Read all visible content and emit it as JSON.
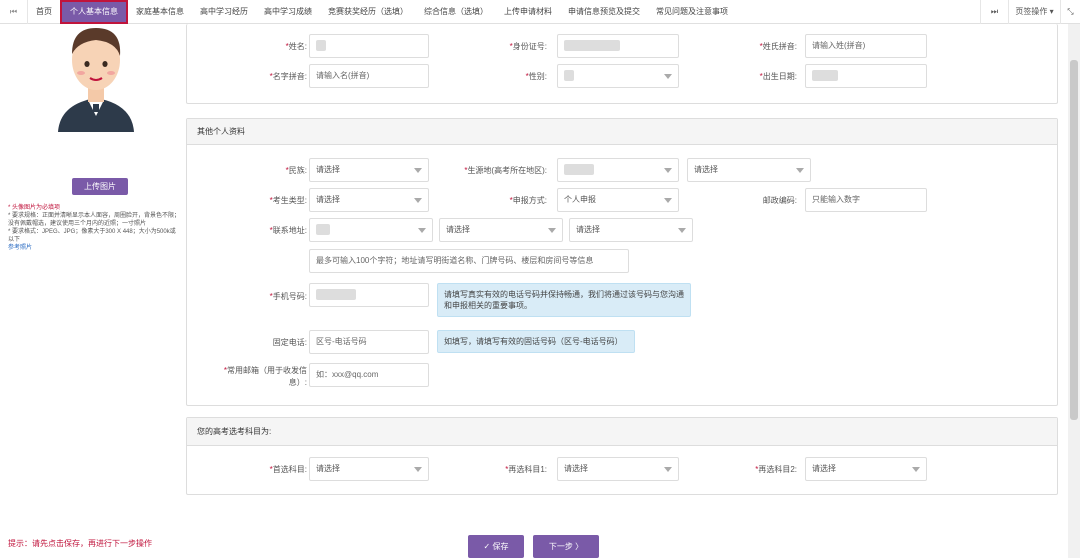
{
  "topbar": {
    "prev_label": "⏮",
    "tabs": [
      "首页",
      "个人基本信息",
      "家庭基本信息",
      "高中学习经历",
      "高中学习成绩",
      "竞赛获奖经历（选填）",
      "综合信息（选填）",
      "上传申请材料",
      "申请信息预览及提交",
      "常见问题及注意事项"
    ],
    "next_label": "⏭",
    "page_ops_label": "页签操作",
    "page_ops_caret": "▾",
    "fullscreen_icon": "⤡"
  },
  "left": {
    "upload_label": "上传图片",
    "notes": [
      "* 头像图片为必填项",
      "* 要求规格：正面并清晰显示本人面容，周圈脸开，背景色不限；没有佩戴帽选，建议使用三个月内的近照；一寸照片",
      "* 要求格式：JPEG、JPG；像素大于300 X 448；大小为500k或以下"
    ],
    "ref_link": "参考照片"
  },
  "basic": {
    "name_label": "姓名:",
    "id_label": "身份证号:",
    "surname_pinyin_label": "姓氏拼音:",
    "surname_pinyin_placeholder": "请输入姓(拼音)",
    "given_pinyin_label": "名字拼音:",
    "given_pinyin_placeholder": "请输入名(拼音)",
    "gender_label": "性别:",
    "birth_label": "出生日期:"
  },
  "other": {
    "title": "其他个人资料",
    "ethnic_label": "民族:",
    "ethnic_value": "请选择",
    "origin_label": "生源地(高考所在地区):",
    "origin_value2": "请选择",
    "examinee_label": "考生类型:",
    "examinee_value": "请选择",
    "apply_label": "申报方式:",
    "apply_value": "个人申报",
    "zip_label": "邮政编码:",
    "zip_placeholder": "只能输入数字",
    "address_label": "联系地址:",
    "address_sel2": "请选择",
    "address_sel3": "请选择",
    "address_placeholder": "最多可输入100个字符；地址请写明街道名称、门牌号码、楼层和房间号等信息",
    "phone_label": "手机号码:",
    "phone_tip": "请填写真实有效的电话号码并保持畅通，我们将通过该号码与您沟通和申报相关的重要事项。",
    "landline_label": "固定电话:",
    "landline_placeholder": "区号-电话号码",
    "landline_tip": "如填写，请填写有效的固话号码（区号-电话号码）",
    "email_label_1": "常用邮箱（用于收发信",
    "email_label_2": "息）:",
    "email_placeholder": "如：xxx@qq.com"
  },
  "subjects": {
    "title": "您的高考选考科目为:",
    "first_label": "首选科目:",
    "first_value": "请选择",
    "second1_label": "再选科目1:",
    "second1_value": "请选择",
    "second2_label": "再选科目2:",
    "second2_value": "请选择"
  },
  "footer": {
    "warning": "提示：请先点击保存，再进行下一步操作",
    "save_label": "✓ 保存",
    "next_label": "下一步 〉"
  },
  "colors": {
    "accent": "#7a5aa8",
    "required": "#c0143c",
    "tip_bg": "#d9ecf7"
  }
}
